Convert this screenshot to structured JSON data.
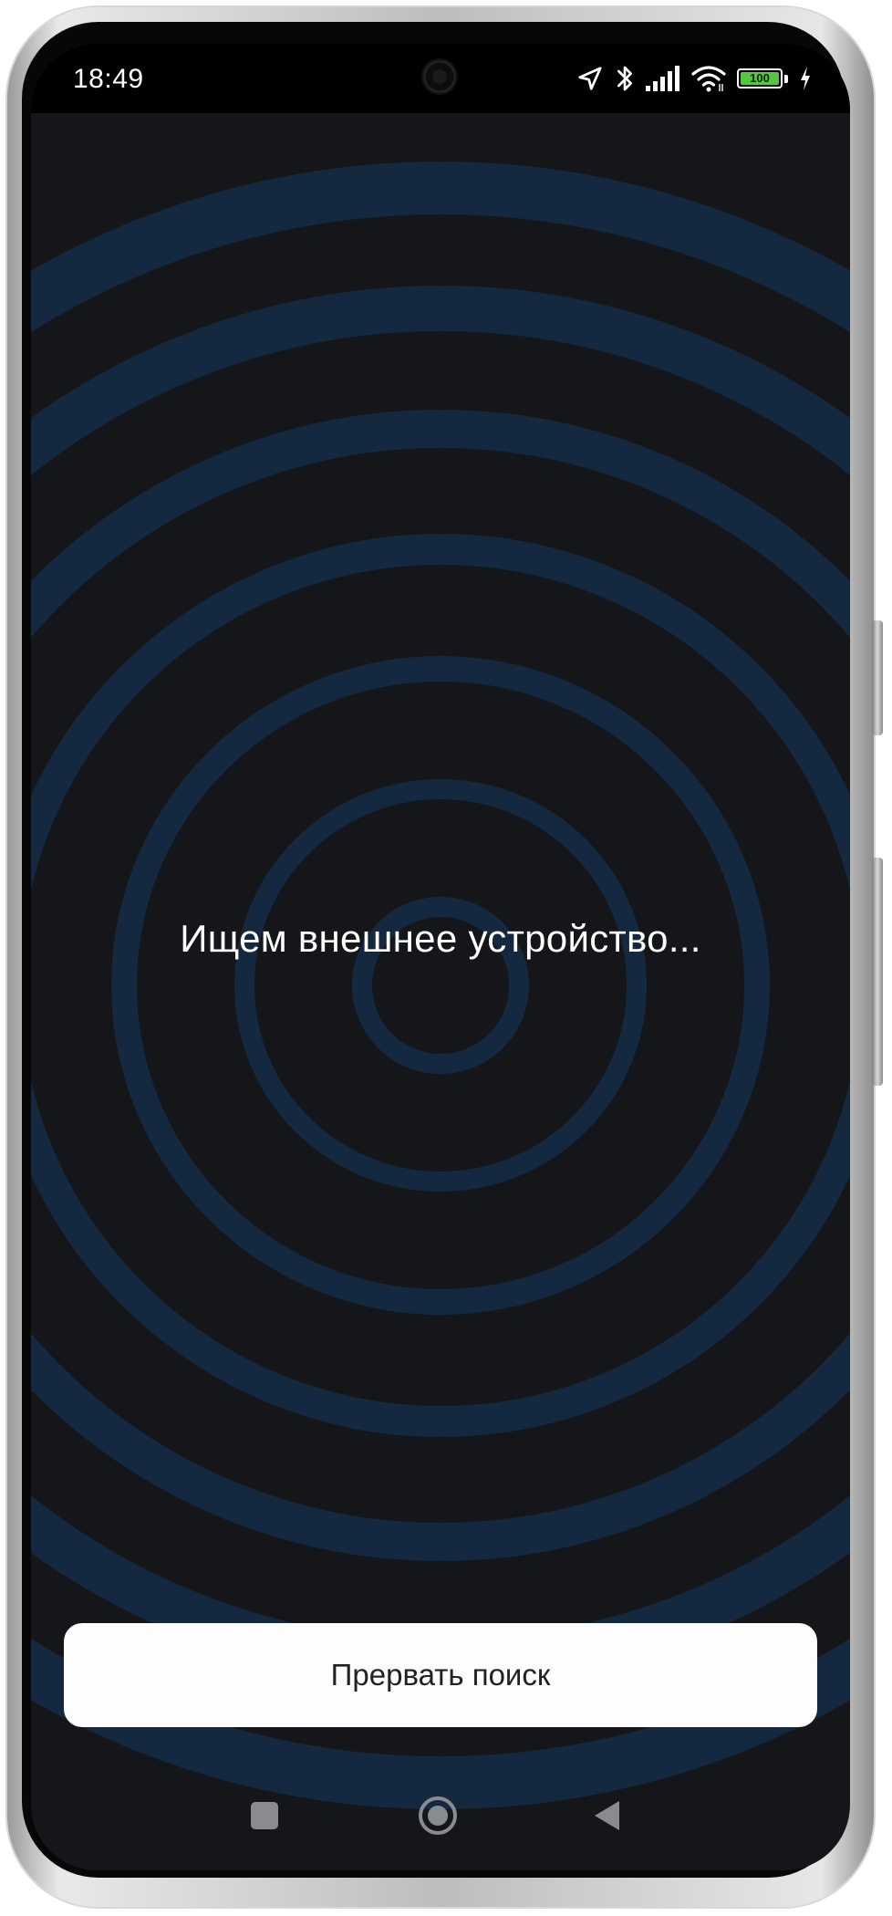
{
  "status_bar": {
    "time": "18:49",
    "battery_level": "100",
    "icons": [
      "location-arrow-icon",
      "bluetooth-icon",
      "signal-icon",
      "wifi-icon",
      "battery-icon",
      "charging-icon"
    ]
  },
  "search_screen": {
    "message": "Ищем внешнее устройство...",
    "stop_button_label": "Прервать поиск"
  },
  "navigation_bar": {
    "items": [
      "recent-apps-icon",
      "home-icon",
      "back-icon"
    ]
  },
  "colors": {
    "screen_background": "#151619",
    "radar_ring": "#14283f",
    "text": "#ffffff",
    "button_background": "#fdfdfd",
    "button_text": "#222222",
    "battery_fill": "#55c640"
  }
}
